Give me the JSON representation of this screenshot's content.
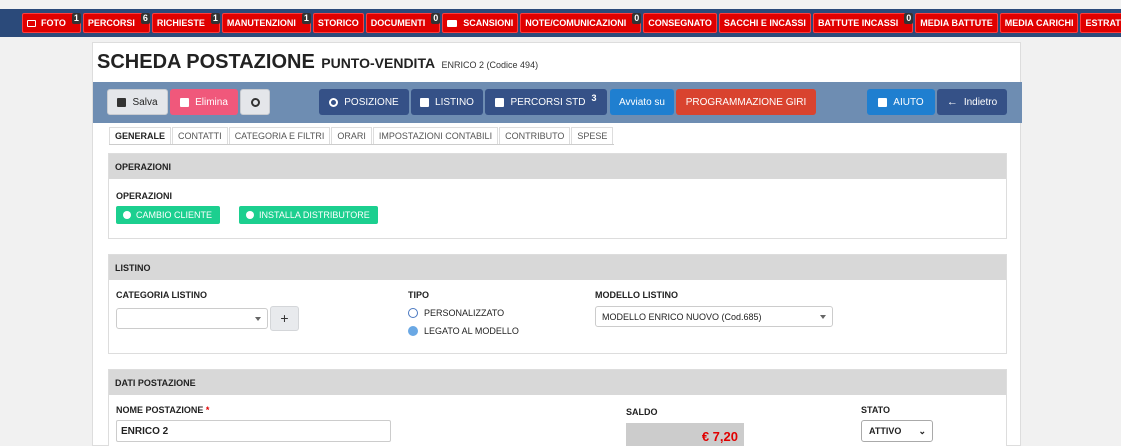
{
  "nav": [
    {
      "label": "FOTO",
      "icon": "photo-icon",
      "badge": "1"
    },
    {
      "label": "PERCORSI",
      "icon": "",
      "badge": "6"
    },
    {
      "label": "RICHIESTE",
      "icon": "",
      "badge": "1"
    },
    {
      "label": "MANUTENZIONI",
      "icon": "",
      "badge": "1"
    },
    {
      "label": "STORICO",
      "icon": "",
      "badge": ""
    },
    {
      "label": "DOCUMENTI",
      "icon": "",
      "badge": "0"
    },
    {
      "label": "SCANSIONI",
      "icon": "folder-icon",
      "badge": ""
    },
    {
      "label": "NOTE/COMUNICAZIONI",
      "icon": "",
      "badge": "0"
    },
    {
      "label": "CONSEGNATO",
      "icon": "",
      "badge": ""
    },
    {
      "label": "SACCHI E INCASSI",
      "icon": "",
      "badge": ""
    },
    {
      "label": "BATTUTE INCASSI",
      "icon": "",
      "badge": "0"
    },
    {
      "label": "MEDIA BATTUTE",
      "icon": "",
      "badge": ""
    },
    {
      "label": "MEDIA CARICHI",
      "icon": "",
      "badge": ""
    },
    {
      "label": "ESTRATTO CONTO",
      "icon": "",
      "badge": ""
    }
  ],
  "header": {
    "title": "SCHEDA POSTAZIONE",
    "subtitle": "PUNTO-VENDITA",
    "detail": "ENRICO 2 (Codice 494)"
  },
  "toolbar": {
    "save": "Salva",
    "delete": "Elimina",
    "position": "POSIZIONE",
    "listino": "LISTINO",
    "percorsi_std": "PERCORSI STD",
    "percorsi_std_count": "3",
    "avviato": "Avviato su",
    "programmazione": "PROGRAMMAZIONE GIRI",
    "help": "AIUTO",
    "back": "Indietro"
  },
  "tabs": [
    "GENERALE",
    "CONTATTI",
    "CATEGORIA E FILTRI",
    "ORARI",
    "IMPOSTAZIONI CONTABILI",
    "CONTRIBUTO",
    "SPESE"
  ],
  "operazioni": {
    "header": "OPERAZIONI",
    "label": "OPERAZIONI",
    "btn_cambio": "CAMBIO CLIENTE",
    "btn_installa": "INSTALLA DISTRIBUTORE"
  },
  "listino": {
    "header": "LISTINO",
    "categoria_label": "CATEGORIA LISTINO",
    "categoria_value": "",
    "plus": "+",
    "tipo_label": "TIPO",
    "tipo_options": [
      "PERSONALIZZATO",
      "LEGATO AL MODELLO"
    ],
    "tipo_selected": "LEGATO AL MODELLO",
    "modello_label": "MODELLO LISTINO",
    "modello_value": "MODELLO ENRICO NUOVO (Cod.685)"
  },
  "dati": {
    "header": "DATI POSTAZIONE",
    "nome_label": "NOME POSTAZIONE",
    "required_mark": "*",
    "nome_value": "ENRICO 2",
    "saldo_label": "SALDO",
    "saldo_value": "€ 7,20",
    "stato_label": "STATO",
    "stato_value": "ATTIVO"
  }
}
